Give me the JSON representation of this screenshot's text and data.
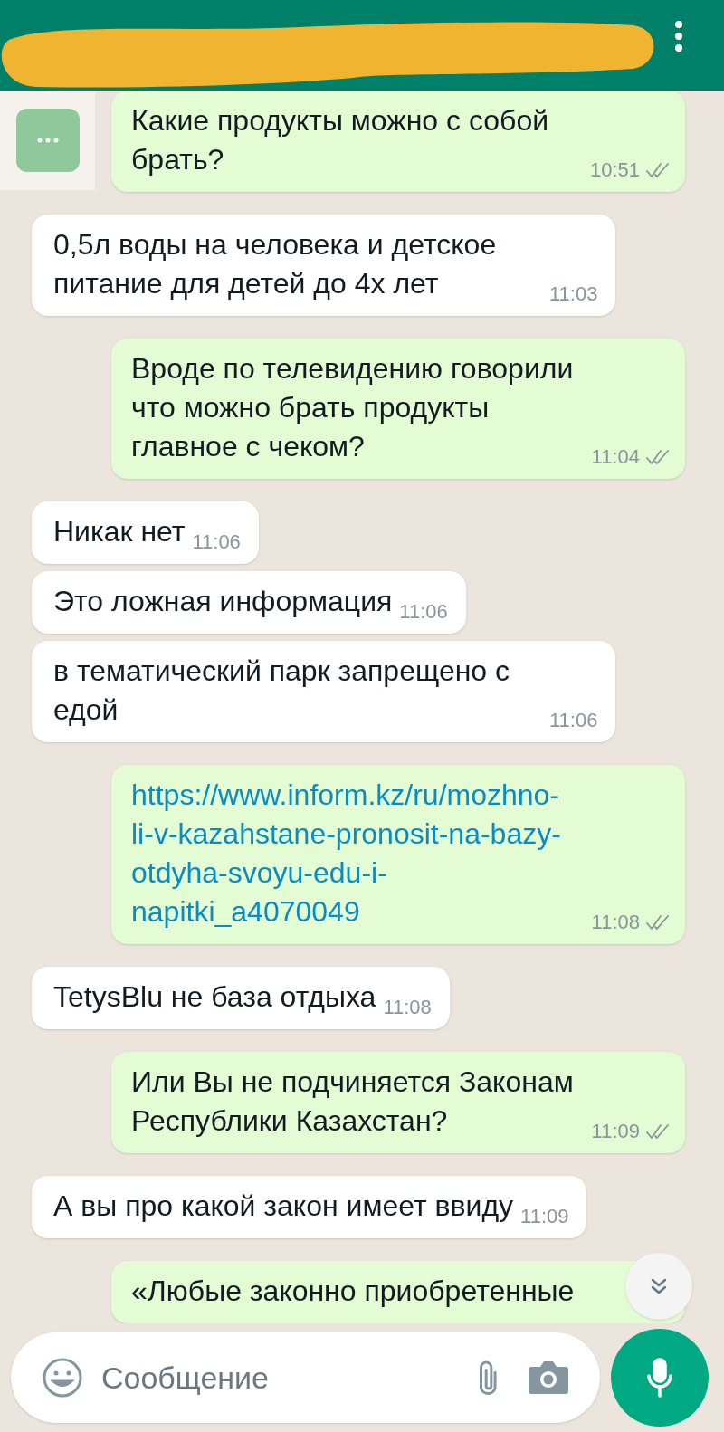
{
  "messages": [
    {
      "outgoing": true,
      "kind": "text",
      "text": "Какие продукты можно с собой брать?",
      "time": "10:51",
      "read": false
    },
    {
      "outgoing": false,
      "kind": "text",
      "text": "0,5л воды на человека и детское питание для детей до 4х лет",
      "time": "11:03"
    },
    {
      "outgoing": true,
      "kind": "text",
      "text": "Вроде по телевидению говорили что можно брать продукты главное с чеком?",
      "time": "11:04",
      "read": false
    },
    {
      "outgoing": false,
      "kind": "text",
      "text": "Никак нет",
      "time": "11:06"
    },
    {
      "outgoing": false,
      "kind": "text",
      "text": "Это ложная информация",
      "time": "11:06"
    },
    {
      "outgoing": false,
      "kind": "text",
      "text": "в тематический парк запрещено с едой",
      "time": "11:06"
    },
    {
      "outgoing": true,
      "kind": "link",
      "text": "https://www.inform.kz/ru/mozhno-li-v-kazahstane-pronosit-na-bazy-otdyha-svoyu-edu-i-napitki_a4070049",
      "time": "11:08",
      "read": false
    },
    {
      "outgoing": false,
      "kind": "text",
      "text": "TetysBlu не база отдыха",
      "time": "11:08"
    },
    {
      "outgoing": true,
      "kind": "text",
      "text": "Или Вы не подчиняется Законам Республики Казахстан?",
      "time": "11:09",
      "read": false
    },
    {
      "outgoing": false,
      "kind": "text",
      "text": "А вы про какой закон имеет ввиду",
      "time": "11:09"
    },
    {
      "outgoing": true,
      "kind": "text",
      "text": "«Любые законно приобретенные"
    }
  ],
  "composer": {
    "placeholder": "Сообщение"
  }
}
